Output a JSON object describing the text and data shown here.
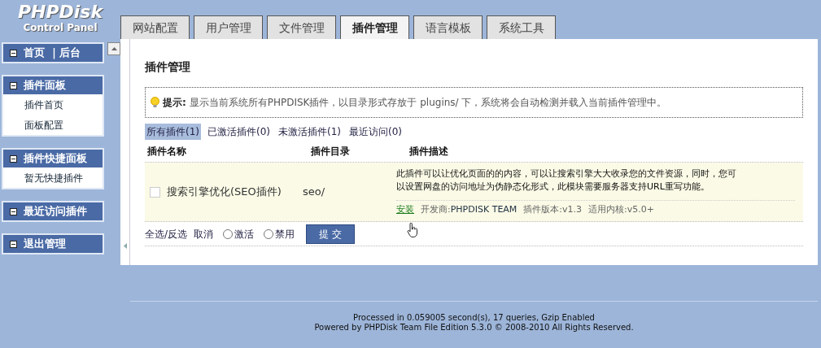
{
  "logo": {
    "title": "PHPDisk",
    "subtitle": "Control Panel"
  },
  "tabs": [
    {
      "label": "网站配置",
      "selected": false
    },
    {
      "label": "用户管理",
      "selected": false
    },
    {
      "label": "文件管理",
      "selected": false
    },
    {
      "label": "插件管理",
      "selected": true
    },
    {
      "label": "语言模板",
      "selected": false
    },
    {
      "label": "系统工具",
      "selected": false
    }
  ],
  "sidebar": [
    {
      "title": "首页 ｜后台"
    },
    {
      "title": "插件面板",
      "items": [
        "插件首页",
        "面板配置"
      ]
    },
    {
      "title": "插件快捷面板",
      "items": [
        "暂无快捷插件"
      ]
    },
    {
      "title": "最近访问插件"
    },
    {
      "title": "退出管理"
    }
  ],
  "page_title": "插件管理",
  "tip": {
    "label": "提示:",
    "text": "显示当前系统所有PHPDISK插件，以目录形式存放于  plugins/ 下，系统将会自动检测并载入当前插件管理中。"
  },
  "filters": [
    {
      "label": "所有插件(1)",
      "selected": true
    },
    {
      "label": "已激活插件(0)",
      "selected": false
    },
    {
      "label": "未激活插件(1)",
      "selected": false
    },
    {
      "label": "最近访问(0)",
      "selected": false
    }
  ],
  "table": {
    "columns": [
      "插件名称",
      "插件目录",
      "插件描述"
    ],
    "rows": [
      {
        "checked": false,
        "name": "搜索引擎优化(SEO插件)",
        "dir": "seo/",
        "description": "此插件可以让优化页面的的内容，可以让搜索引擎大大收录您的文件资源，同时，您可以设置网盘的访问地址为伪静态化形式，此模块需要服务器支持URL重写功能。",
        "action": "安装",
        "developer": "开发商:",
        "developer_name": "PHPDISK TEAM",
        "version": "插件版本:v1.3",
        "core": "适用内核:v5.0+"
      }
    ]
  },
  "actions": {
    "select_all": "全选/反选",
    "cancel": "取消",
    "radios": [
      {
        "label": "激活",
        "selected": false
      },
      {
        "label": "禁用",
        "selected": false
      }
    ],
    "submit": "提 交"
  },
  "footer": [
    "Processed in 0.059005 second(s), 17 queries, Gzip Enabled",
    "Powered by PHPDisk Team File Edition 5.3.0 © 2008-2010 All Rights Reserved."
  ]
}
